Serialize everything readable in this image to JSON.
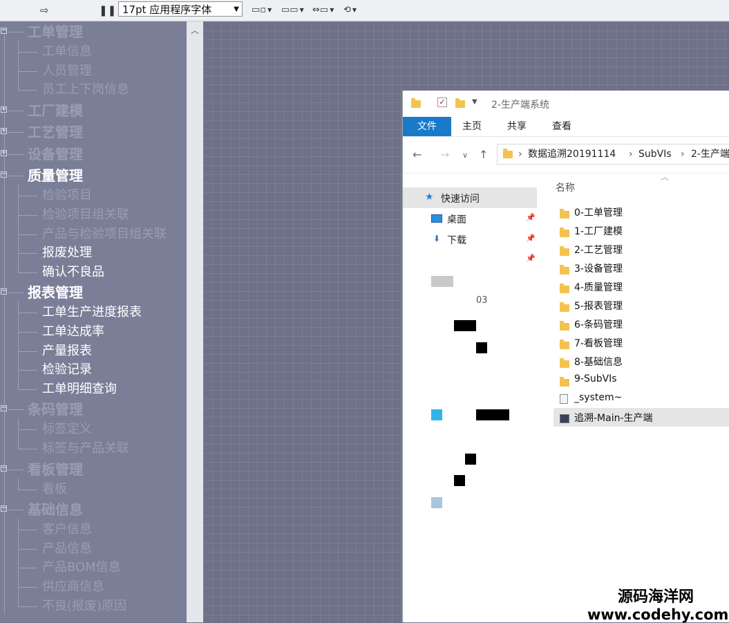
{
  "toolbar": {
    "font_select_value": "17pt 应用程序字体",
    "icons": [
      "run-arrow-icon",
      "pause-icon",
      "align-icon",
      "distribute-icon",
      "resize-icon",
      "reorder-icon"
    ]
  },
  "tree": {
    "categories": [
      {
        "label": "工单管理",
        "children": [
          "工单信息",
          "人员管理",
          "员工上下岗信息"
        ]
      },
      {
        "label": "工厂建模",
        "children": []
      },
      {
        "label": "工艺管理",
        "children": []
      },
      {
        "label": "设备管理",
        "children": []
      },
      {
        "label": "质量管理",
        "children": [
          "检验项目",
          "检验项目组关联",
          "产品与检验项目组关联",
          "报废处理",
          "确认不良品"
        ]
      },
      {
        "label": "报表管理",
        "children": [
          "工单生产进度报表",
          "工单达成率",
          "产量报表",
          "检验记录",
          "工单明细查询"
        ]
      },
      {
        "label": "条码管理",
        "children": [
          "标签定义",
          "标签与产品关联"
        ]
      },
      {
        "label": "看板管理",
        "children": [
          "看板"
        ]
      },
      {
        "label": "基础信息",
        "children": [
          "客户信息",
          "产品信息",
          "产品BOM信息",
          "供应商信息",
          "不良(报废)原因"
        ]
      }
    ]
  },
  "explorer": {
    "title": "2-生产端系统",
    "ribbon_tabs": [
      "文件",
      "主页",
      "共享",
      "查看"
    ],
    "address_parts": [
      "数据追溯20191114",
      "SubVIs",
      "2-生产端"
    ],
    "nav": {
      "quick_access": "快速访问",
      "desktop": "桌面",
      "downloads": "下载",
      "partial_text": "03"
    },
    "column_name": "名称",
    "files": [
      "0-工单管理",
      "1-工厂建模",
      "2-工艺管理",
      "3-设备管理",
      "4-质量管理",
      "5-报表管理",
      "6-条码管理",
      "7-看板管理",
      "8-基础信息",
      "9-SubVIs",
      "_system~",
      "追溯-Main-生产端"
    ]
  },
  "watermark": {
    "line1": "源码海洋网",
    "line2": "www.codehy.com"
  }
}
